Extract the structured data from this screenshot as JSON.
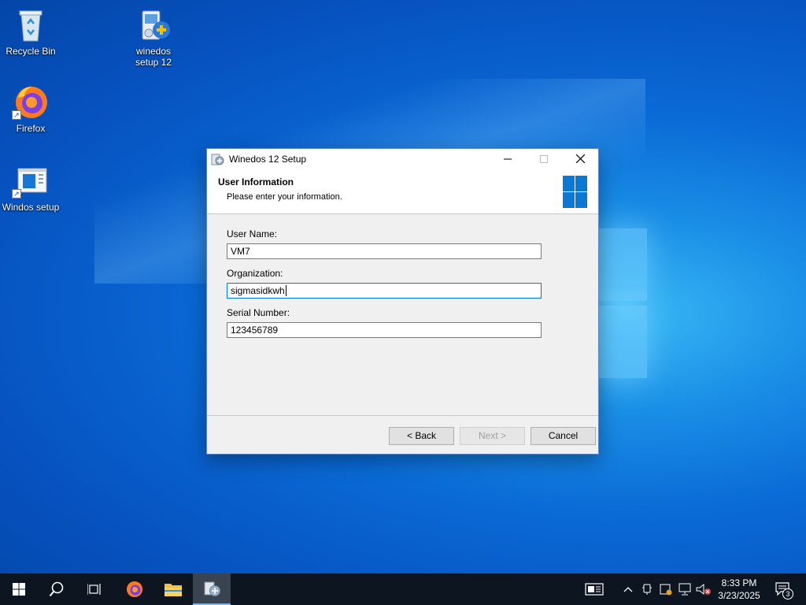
{
  "desktop": {
    "icons": [
      {
        "label": "Recycle Bin",
        "icon": "recycle-bin-icon"
      },
      {
        "label": "winedos setup 12",
        "icon": "setup-installer-icon"
      },
      {
        "label": "Firefox",
        "icon": "firefox-icon"
      },
      {
        "label": "Windos setup",
        "icon": "setup-window-icon"
      }
    ]
  },
  "dialog": {
    "title": "Winedos 12  Setup",
    "header_title": "User Information",
    "header_subtitle": "Please enter your information.",
    "fields": [
      {
        "label": "User Name:",
        "value": "VM7"
      },
      {
        "label": "Organization:",
        "value": "sigmasidkwh"
      },
      {
        "label": "Serial Number:",
        "value": "123456789"
      }
    ],
    "buttons": {
      "back": "< Back",
      "next": "Next >",
      "cancel": "Cancel"
    },
    "controls": {
      "minimize": "—",
      "maximize": "□",
      "close": "✕"
    }
  },
  "taskbar": {
    "clock_time": "8:33 PM",
    "clock_date": "3/23/2025",
    "notification_count": "3"
  },
  "colors": {
    "accent": "#0078d7",
    "taskbar": "#0d1520",
    "win_logo": "#0a78d4"
  }
}
